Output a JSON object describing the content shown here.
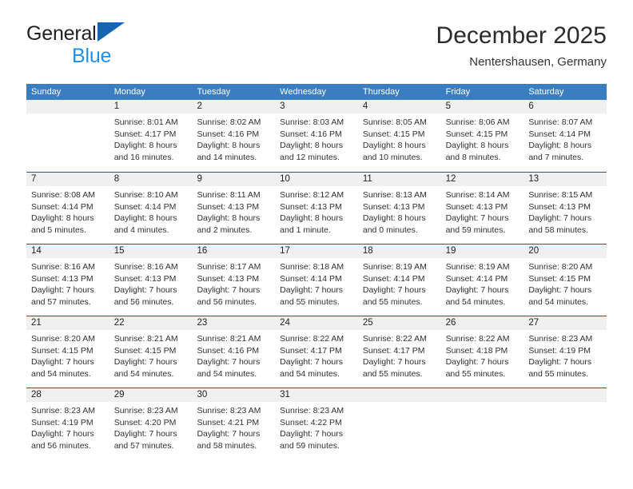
{
  "brand": {
    "name_part1": "General",
    "name_part2": "Blue"
  },
  "header": {
    "title": "December 2025",
    "subtitle": "Nentershausen, Germany"
  },
  "colors": {
    "header_blue": "#3a7ebf",
    "row_divider_blue": "#1d5a96",
    "day_band_gray": "#f0f0f0",
    "brand_blue": "#1f8fe0",
    "brand_triangle_blue": "#1665b5"
  },
  "weekdays": [
    "Sunday",
    "Monday",
    "Tuesday",
    "Wednesday",
    "Thursday",
    "Friday",
    "Saturday"
  ],
  "weeks": [
    [
      {
        "day": "",
        "sunrise": "",
        "sunset": "",
        "daylight_line1": "",
        "daylight_line2": ""
      },
      {
        "day": "1",
        "sunrise": "Sunrise: 8:01 AM",
        "sunset": "Sunset: 4:17 PM",
        "daylight_line1": "Daylight: 8 hours",
        "daylight_line2": "and 16 minutes."
      },
      {
        "day": "2",
        "sunrise": "Sunrise: 8:02 AM",
        "sunset": "Sunset: 4:16 PM",
        "daylight_line1": "Daylight: 8 hours",
        "daylight_line2": "and 14 minutes."
      },
      {
        "day": "3",
        "sunrise": "Sunrise: 8:03 AM",
        "sunset": "Sunset: 4:16 PM",
        "daylight_line1": "Daylight: 8 hours",
        "daylight_line2": "and 12 minutes."
      },
      {
        "day": "4",
        "sunrise": "Sunrise: 8:05 AM",
        "sunset": "Sunset: 4:15 PM",
        "daylight_line1": "Daylight: 8 hours",
        "daylight_line2": "and 10 minutes."
      },
      {
        "day": "5",
        "sunrise": "Sunrise: 8:06 AM",
        "sunset": "Sunset: 4:15 PM",
        "daylight_line1": "Daylight: 8 hours",
        "daylight_line2": "and 8 minutes."
      },
      {
        "day": "6",
        "sunrise": "Sunrise: 8:07 AM",
        "sunset": "Sunset: 4:14 PM",
        "daylight_line1": "Daylight: 8 hours",
        "daylight_line2": "and 7 minutes."
      }
    ],
    [
      {
        "day": "7",
        "sunrise": "Sunrise: 8:08 AM",
        "sunset": "Sunset: 4:14 PM",
        "daylight_line1": "Daylight: 8 hours",
        "daylight_line2": "and 5 minutes."
      },
      {
        "day": "8",
        "sunrise": "Sunrise: 8:10 AM",
        "sunset": "Sunset: 4:14 PM",
        "daylight_line1": "Daylight: 8 hours",
        "daylight_line2": "and 4 minutes."
      },
      {
        "day": "9",
        "sunrise": "Sunrise: 8:11 AM",
        "sunset": "Sunset: 4:13 PM",
        "daylight_line1": "Daylight: 8 hours",
        "daylight_line2": "and 2 minutes."
      },
      {
        "day": "10",
        "sunrise": "Sunrise: 8:12 AM",
        "sunset": "Sunset: 4:13 PM",
        "daylight_line1": "Daylight: 8 hours",
        "daylight_line2": "and 1 minute."
      },
      {
        "day": "11",
        "sunrise": "Sunrise: 8:13 AM",
        "sunset": "Sunset: 4:13 PM",
        "daylight_line1": "Daylight: 8 hours",
        "daylight_line2": "and 0 minutes."
      },
      {
        "day": "12",
        "sunrise": "Sunrise: 8:14 AM",
        "sunset": "Sunset: 4:13 PM",
        "daylight_line1": "Daylight: 7 hours",
        "daylight_line2": "and 59 minutes."
      },
      {
        "day": "13",
        "sunrise": "Sunrise: 8:15 AM",
        "sunset": "Sunset: 4:13 PM",
        "daylight_line1": "Daylight: 7 hours",
        "daylight_line2": "and 58 minutes."
      }
    ],
    [
      {
        "day": "14",
        "sunrise": "Sunrise: 8:16 AM",
        "sunset": "Sunset: 4:13 PM",
        "daylight_line1": "Daylight: 7 hours",
        "daylight_line2": "and 57 minutes."
      },
      {
        "day": "15",
        "sunrise": "Sunrise: 8:16 AM",
        "sunset": "Sunset: 4:13 PM",
        "daylight_line1": "Daylight: 7 hours",
        "daylight_line2": "and 56 minutes."
      },
      {
        "day": "16",
        "sunrise": "Sunrise: 8:17 AM",
        "sunset": "Sunset: 4:13 PM",
        "daylight_line1": "Daylight: 7 hours",
        "daylight_line2": "and 56 minutes."
      },
      {
        "day": "17",
        "sunrise": "Sunrise: 8:18 AM",
        "sunset": "Sunset: 4:14 PM",
        "daylight_line1": "Daylight: 7 hours",
        "daylight_line2": "and 55 minutes."
      },
      {
        "day": "18",
        "sunrise": "Sunrise: 8:19 AM",
        "sunset": "Sunset: 4:14 PM",
        "daylight_line1": "Daylight: 7 hours",
        "daylight_line2": "and 55 minutes."
      },
      {
        "day": "19",
        "sunrise": "Sunrise: 8:19 AM",
        "sunset": "Sunset: 4:14 PM",
        "daylight_line1": "Daylight: 7 hours",
        "daylight_line2": "and 54 minutes."
      },
      {
        "day": "20",
        "sunrise": "Sunrise: 8:20 AM",
        "sunset": "Sunset: 4:15 PM",
        "daylight_line1": "Daylight: 7 hours",
        "daylight_line2": "and 54 minutes."
      }
    ],
    [
      {
        "day": "21",
        "sunrise": "Sunrise: 8:20 AM",
        "sunset": "Sunset: 4:15 PM",
        "daylight_line1": "Daylight: 7 hours",
        "daylight_line2": "and 54 minutes."
      },
      {
        "day": "22",
        "sunrise": "Sunrise: 8:21 AM",
        "sunset": "Sunset: 4:15 PM",
        "daylight_line1": "Daylight: 7 hours",
        "daylight_line2": "and 54 minutes."
      },
      {
        "day": "23",
        "sunrise": "Sunrise: 8:21 AM",
        "sunset": "Sunset: 4:16 PM",
        "daylight_line1": "Daylight: 7 hours",
        "daylight_line2": "and 54 minutes."
      },
      {
        "day": "24",
        "sunrise": "Sunrise: 8:22 AM",
        "sunset": "Sunset: 4:17 PM",
        "daylight_line1": "Daylight: 7 hours",
        "daylight_line2": "and 54 minutes."
      },
      {
        "day": "25",
        "sunrise": "Sunrise: 8:22 AM",
        "sunset": "Sunset: 4:17 PM",
        "daylight_line1": "Daylight: 7 hours",
        "daylight_line2": "and 55 minutes."
      },
      {
        "day": "26",
        "sunrise": "Sunrise: 8:22 AM",
        "sunset": "Sunset: 4:18 PM",
        "daylight_line1": "Daylight: 7 hours",
        "daylight_line2": "and 55 minutes."
      },
      {
        "day": "27",
        "sunrise": "Sunrise: 8:23 AM",
        "sunset": "Sunset: 4:19 PM",
        "daylight_line1": "Daylight: 7 hours",
        "daylight_line2": "and 55 minutes."
      }
    ],
    [
      {
        "day": "28",
        "sunrise": "Sunrise: 8:23 AM",
        "sunset": "Sunset: 4:19 PM",
        "daylight_line1": "Daylight: 7 hours",
        "daylight_line2": "and 56 minutes."
      },
      {
        "day": "29",
        "sunrise": "Sunrise: 8:23 AM",
        "sunset": "Sunset: 4:20 PM",
        "daylight_line1": "Daylight: 7 hours",
        "daylight_line2": "and 57 minutes."
      },
      {
        "day": "30",
        "sunrise": "Sunrise: 8:23 AM",
        "sunset": "Sunset: 4:21 PM",
        "daylight_line1": "Daylight: 7 hours",
        "daylight_line2": "and 58 minutes."
      },
      {
        "day": "31",
        "sunrise": "Sunrise: 8:23 AM",
        "sunset": "Sunset: 4:22 PM",
        "daylight_line1": "Daylight: 7 hours",
        "daylight_line2": "and 59 minutes."
      },
      {
        "day": "",
        "sunrise": "",
        "sunset": "",
        "daylight_line1": "",
        "daylight_line2": ""
      },
      {
        "day": "",
        "sunrise": "",
        "sunset": "",
        "daylight_line1": "",
        "daylight_line2": ""
      },
      {
        "day": "",
        "sunrise": "",
        "sunset": "",
        "daylight_line1": "",
        "daylight_line2": ""
      }
    ]
  ]
}
